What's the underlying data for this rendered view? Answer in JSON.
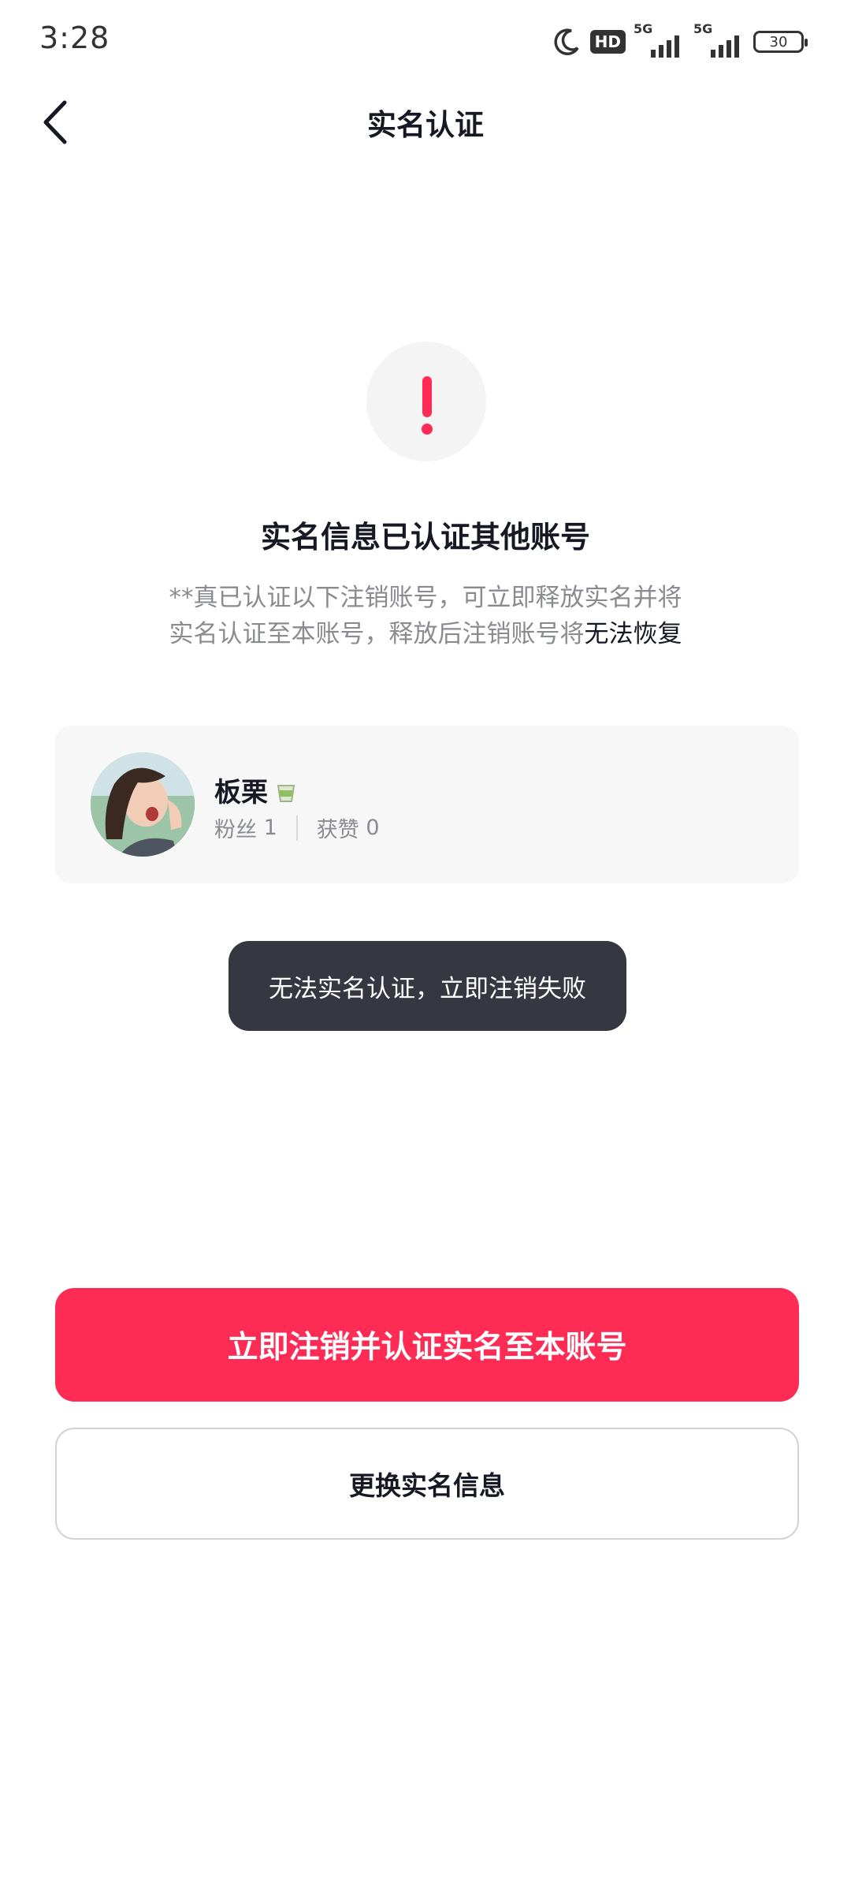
{
  "status_bar": {
    "time": "3:28",
    "hd_label": "HD",
    "signal1_label": "5G",
    "signal2_label": "5G",
    "battery": "30"
  },
  "header": {
    "title": "实名认证",
    "back_icon": "chevron-left-icon"
  },
  "warning": {
    "icon": "exclamation-icon",
    "accent": "#fe2c55",
    "heading": "实名信息已认证其他账号",
    "desc_line1": "**真已认证以下注销账号，可立即释放实名并将",
    "desc_line2_pre": "实名认证至本账号，释放后注销账号将",
    "desc_line2_strong": "无法恢复"
  },
  "account": {
    "name": "板栗",
    "emoji_icon": "tea-cup-icon",
    "fans_label": "粉丝",
    "fans_count": "1",
    "likes_label": "获赞",
    "likes_count": "0"
  },
  "toast": {
    "text": "无法实名认证，立即注销失败"
  },
  "actions": {
    "primary_label": "立即注销并认证实名至本账号",
    "primary_color": "#fe2c55",
    "secondary_label": "更换实名信息"
  }
}
